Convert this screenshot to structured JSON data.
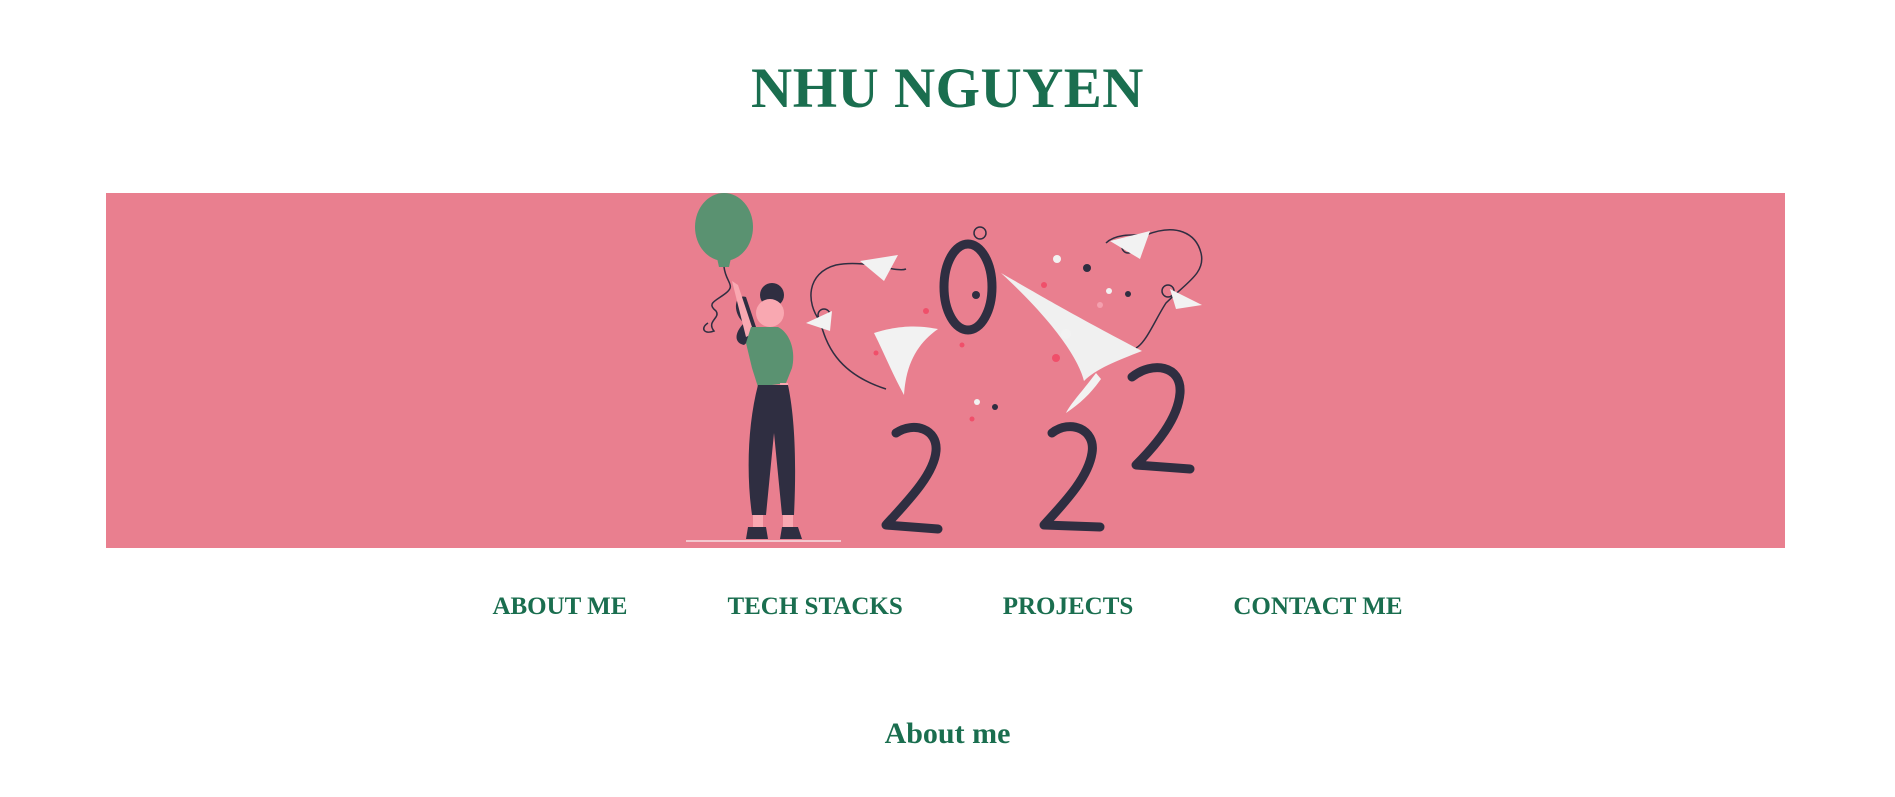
{
  "header": {
    "title": "NHU NGUYEN"
  },
  "banner": {
    "background_color": "#e97f8f",
    "illustration": "woman-with-balloon-2022-illustration"
  },
  "nav": {
    "items": [
      {
        "label": "ABOUT ME"
      },
      {
        "label": "TECH STACKS"
      },
      {
        "label": "PROJECTS"
      },
      {
        "label": "CONTACT ME"
      }
    ]
  },
  "about": {
    "heading": "About me"
  },
  "colors": {
    "accent": "#1a6e4f",
    "figure_green": "#5a9271",
    "dark": "#2f2e41"
  }
}
